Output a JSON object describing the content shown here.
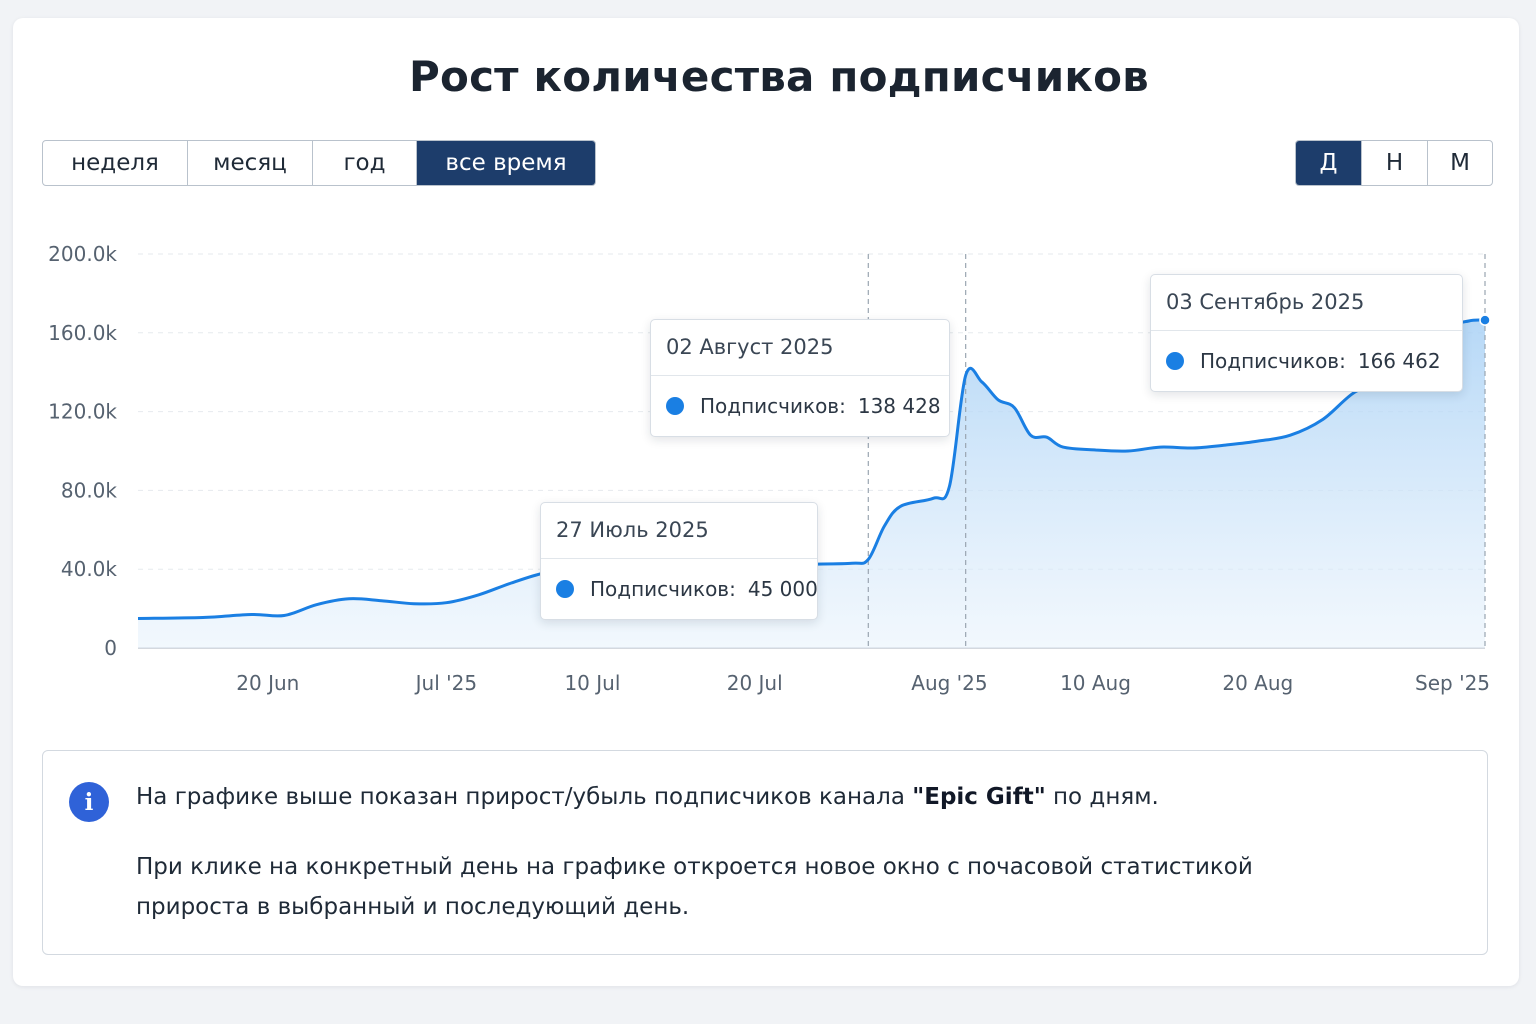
{
  "title": "Рост количества подписчиков",
  "period_tabs": [
    {
      "label": "неделя",
      "active": false
    },
    {
      "label": "месяц",
      "active": false
    },
    {
      "label": "год",
      "active": false
    },
    {
      "label": "все время",
      "active": true
    }
  ],
  "granularity_tabs": [
    {
      "label": "Д",
      "active": true
    },
    {
      "label": "Н",
      "active": false
    },
    {
      "label": "М",
      "active": false
    }
  ],
  "colors": {
    "line": "#1a7fe3",
    "area": "#bcdcf7",
    "active_tab": "#1d3d6b",
    "info_icon": "#2f62d8"
  },
  "chart_data": {
    "type": "area",
    "title": "",
    "xlabel": "",
    "ylabel": "",
    "ylim": [
      0,
      200000
    ],
    "yticks": [
      0,
      40000,
      80000,
      120000,
      160000,
      200000
    ],
    "ytick_labels": [
      "0",
      "40.0k",
      "80.0k",
      "120.0k",
      "160.0k",
      "200.0k"
    ],
    "xlim": [
      "2025-06-12",
      "2025-09-03"
    ],
    "xticks": [
      "2025-06-20",
      "2025-07-01",
      "2025-07-10",
      "2025-07-20",
      "2025-08-01",
      "2025-08-10",
      "2025-08-20",
      "2025-09-01"
    ],
    "xtick_labels": [
      "20 Jun",
      "Jul '25",
      "10 Jul",
      "20 Jul",
      "Aug '25",
      "10 Aug",
      "20 Aug",
      "Sep '25"
    ],
    "grid": true,
    "series": [
      {
        "name": "Подписчиков",
        "x": [
          "2025-06-12",
          "2025-06-16",
          "2025-06-19",
          "2025-06-21",
          "2025-06-23",
          "2025-06-25",
          "2025-06-27",
          "2025-06-29",
          "2025-07-01",
          "2025-07-03",
          "2025-07-05",
          "2025-07-07",
          "2025-07-09",
          "2025-07-11",
          "2025-07-15",
          "2025-07-19",
          "2025-07-23",
          "2025-07-26",
          "2025-07-27",
          "2025-07-28",
          "2025-07-29",
          "2025-07-31",
          "2025-08-01",
          "2025-08-02",
          "2025-08-03",
          "2025-08-04",
          "2025-08-05",
          "2025-08-06",
          "2025-08-07",
          "2025-08-08",
          "2025-08-10",
          "2025-08-12",
          "2025-08-14",
          "2025-08-16",
          "2025-08-18",
          "2025-08-20",
          "2025-08-22",
          "2025-08-24",
          "2025-08-26",
          "2025-08-28",
          "2025-08-30",
          "2025-09-01",
          "2025-09-02",
          "2025-09-03"
        ],
        "y": [
          15000,
          15500,
          17000,
          16500,
          22000,
          25000,
          24000,
          22500,
          23000,
          27000,
          33000,
          38000,
          40000,
          41000,
          41500,
          42000,
          42500,
          43000,
          45000,
          62000,
          72000,
          76000,
          82000,
          138428,
          135000,
          126000,
          122000,
          108000,
          107000,
          102000,
          100500,
          100000,
          102000,
          101500,
          103000,
          105000,
          108000,
          116000,
          130000,
          136000,
          140000,
          162000,
          166000,
          166462
        ]
      }
    ],
    "markers": [
      {
        "x": "2025-07-27",
        "style": "dashed-vertical"
      },
      {
        "x": "2025-08-02",
        "style": "dashed-vertical"
      },
      {
        "x": "2025-09-03",
        "style": "dashed-vertical"
      }
    ],
    "tooltips": [
      {
        "date": "27 Июль 2025",
        "label": "Подписчиков:",
        "value": "45 000"
      },
      {
        "date": "02 Август 2025",
        "label": "Подписчиков:",
        "value": "138 428"
      },
      {
        "date": "03 Сентябрь 2025",
        "label": "Подписчиков:",
        "value": "166 462"
      }
    ]
  },
  "info": {
    "icon": "info-icon",
    "line1_pre": "На графике выше показан прирост/убыль подписчиков канала ",
    "line1_bold": "\"Epic Gift\"",
    "line1_post": " по дням.",
    "line2": "При клике на конкретный день на графике откроется новое окно с почасовой статистикой прироста в выбранный и последующий день."
  }
}
